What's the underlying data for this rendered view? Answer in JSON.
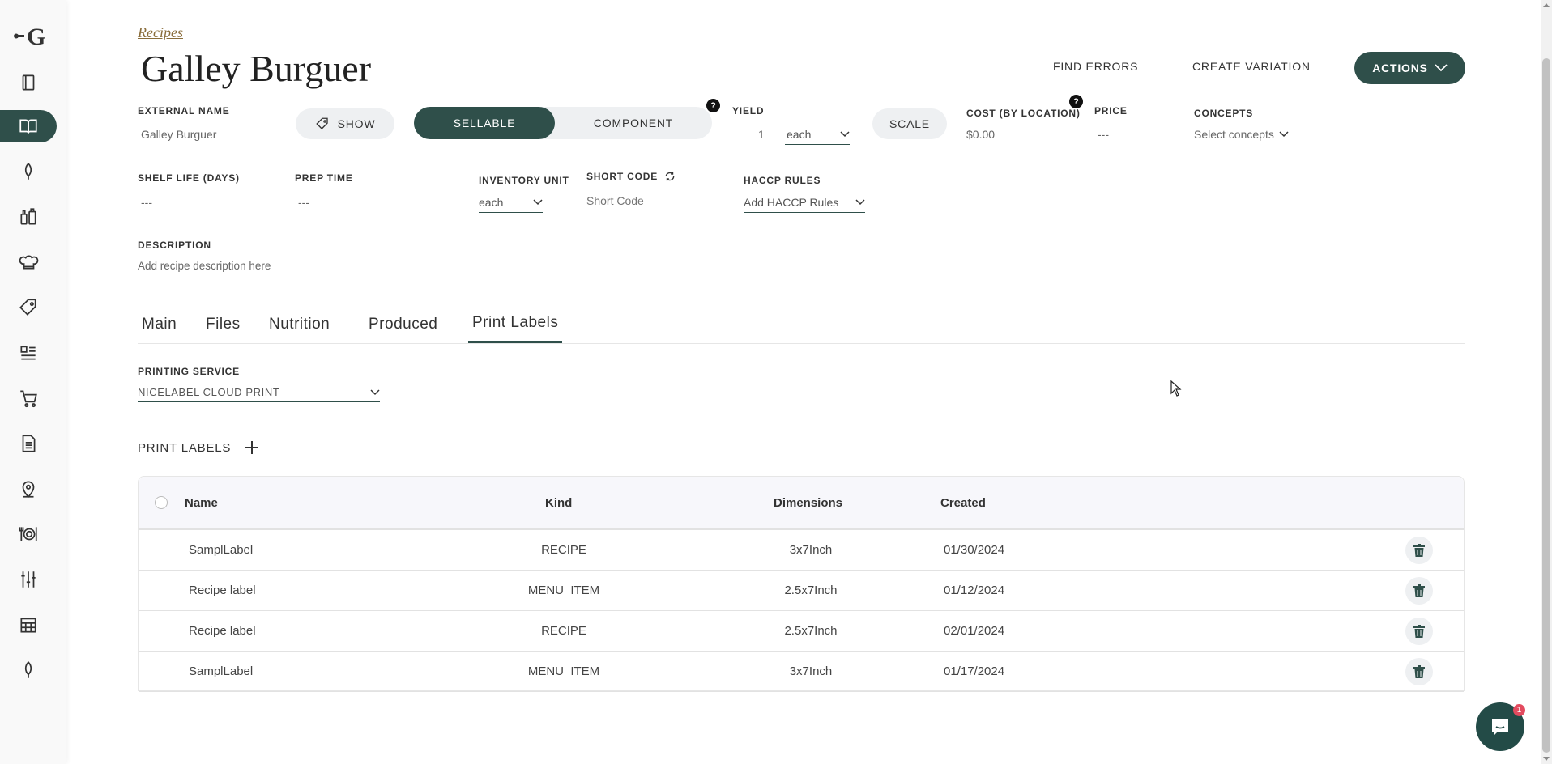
{
  "breadcrumb": "Recipes",
  "title": "Galley Burguer",
  "header_actions": {
    "find_errors": "FIND ERRORS",
    "create_variation": "CREATE VARIATION",
    "actions": "ACTIONS"
  },
  "fields": {
    "external_name_label": "EXTERNAL NAME",
    "external_name_value": "Galley Burguer",
    "show_label": "SHOW",
    "sellable": "SELLABLE",
    "component": "COMPONENT",
    "help": "?",
    "yield_label": "YIELD",
    "yield_qty": "1",
    "yield_unit": "each",
    "scale": "SCALE",
    "cost_label": "COST (BY LOCATION)",
    "cost_value": "$0.00",
    "price_label": "PRICE",
    "price_value": "---",
    "concepts_label": "CONCEPTS",
    "concepts_value": "Select concepts",
    "shelf_life_label": "SHELF LIFE (DAYS)",
    "shelf_life_value": "---",
    "prep_time_label": "PREP TIME",
    "prep_time_value": "---",
    "inventory_unit_label": "INVENTORY UNIT",
    "inventory_unit_value": "each",
    "short_code_label": "SHORT CODE",
    "short_code_placeholder": "Short Code",
    "haccp_label": "HACCP RULES",
    "haccp_value": "Add HACCP Rules",
    "description_label": "DESCRIPTION",
    "description_value": "Add recipe description here"
  },
  "tabs": [
    "Main",
    "Files",
    "Nutrition",
    "Produced",
    "Print Labels"
  ],
  "printing_service": {
    "label": "PRINTING SERVICE",
    "value": "NICELABEL CLOUD PRINT"
  },
  "print_labels": {
    "title": "PRINT LABELS",
    "columns": [
      "Name",
      "Kind",
      "Dimensions",
      "Created"
    ],
    "rows": [
      {
        "name": "SamplLabel",
        "kind": "RECIPE",
        "dimensions": "3x7Inch",
        "created": "01/30/2024"
      },
      {
        "name": "Recipe label",
        "kind": "MENU_ITEM",
        "dimensions": "2.5x7Inch",
        "created": "01/12/2024"
      },
      {
        "name": "Recipe label",
        "kind": "RECIPE",
        "dimensions": "2.5x7Inch",
        "created": "02/01/2024"
      },
      {
        "name": "SamplLabel",
        "kind": "MENU_ITEM",
        "dimensions": "3x7Inch",
        "created": "01/17/2024"
      }
    ]
  },
  "chat_badge": "1",
  "colors": {
    "accent": "#2f4f4a",
    "breadcrumb": "#8a6d3b",
    "badge": "#e34b5f"
  },
  "icons": {
    "sidebar": [
      "book-stack-icon",
      "open-book-icon",
      "leaf-icon",
      "bottles-icon",
      "chef-hat-icon",
      "tag-icon",
      "checklist-icon",
      "cart-icon",
      "document-icon",
      "map-pin-icon",
      "dish-icon",
      "sliders-icon",
      "calendar-icon",
      "leaf-icon"
    ]
  }
}
